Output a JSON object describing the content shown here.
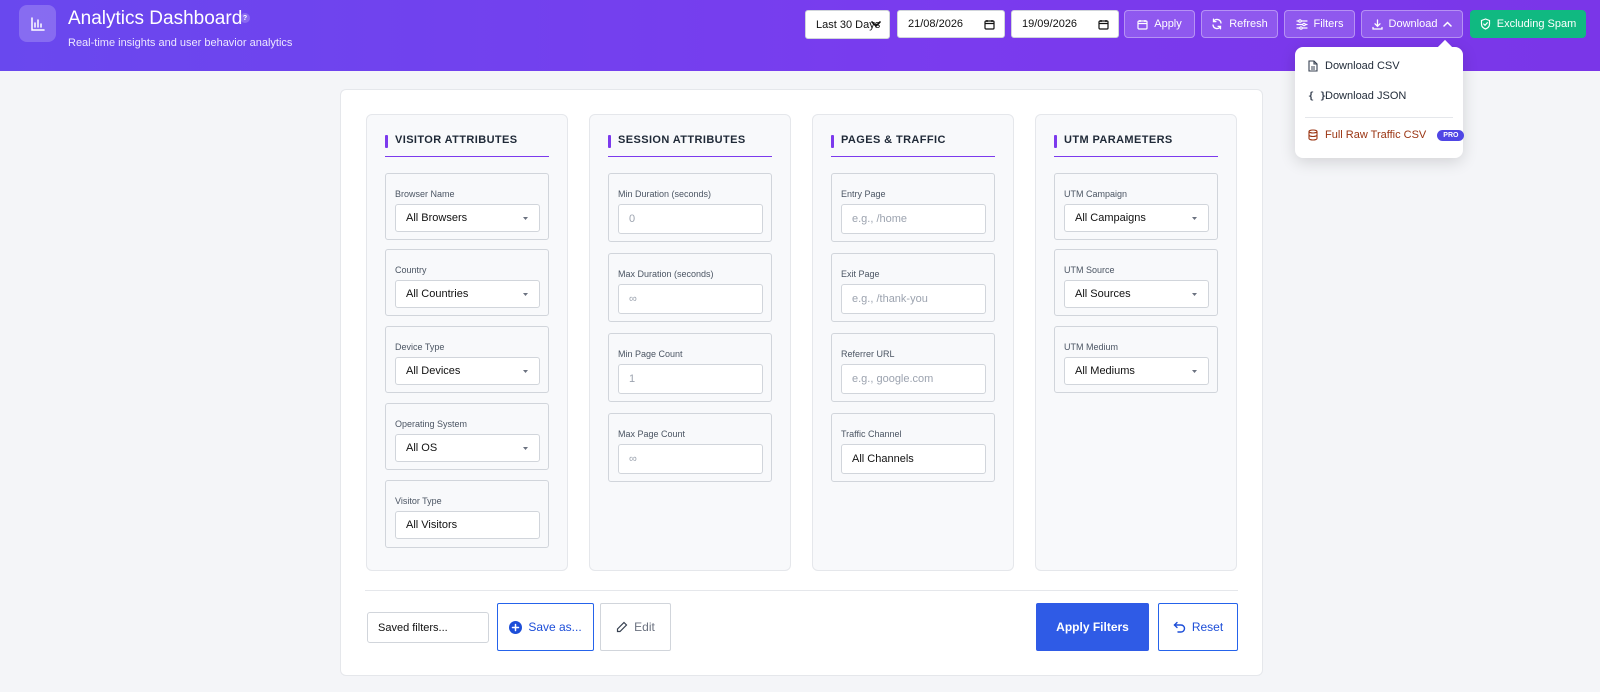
{
  "header": {
    "title": "Analytics Dashboard",
    "info_badge": "?",
    "subtitle": "Real-time insights and user behavior analytics",
    "range_select": "Last 30 Days",
    "start_date": "21/08/2026",
    "end_date": "19/09/2026",
    "apply_label": "Apply",
    "refresh_label": "Refresh",
    "filters_label": "Filters",
    "download_label": "Download",
    "spam_label": "Excluding Spam",
    "icons": [
      "bar-chart-icon",
      "calendar-icon",
      "refresh-icon",
      "sliders-icon",
      "download-icon",
      "chevron-up-icon",
      "shield-check-icon"
    ]
  },
  "download_menu": {
    "csv_label": "Download CSV",
    "json_label": "Download JSON",
    "json_glyph": "{ }",
    "raw_label": "Full Raw Traffic CSV",
    "pro_badge": "PRO"
  },
  "columns": [
    {
      "title": "VISITOR ATTRIBUTES",
      "fields": [
        {
          "label": "Browser Name",
          "value": "All Browsers"
        },
        {
          "label": "Country",
          "value": "All Countries"
        },
        {
          "label": "Device Type",
          "value": "All Devices"
        },
        {
          "label": "Operating System",
          "value": "All OS"
        },
        {
          "label": "Visitor Type",
          "value": "All Visitors"
        }
      ]
    },
    {
      "title": "SESSION ATTRIBUTES",
      "fields": [
        {
          "label": "Min Duration (seconds)",
          "placeholder": "0"
        },
        {
          "label": "Max Duration (seconds)",
          "placeholder": "∞"
        },
        {
          "label": "Min Page Count",
          "placeholder": "1"
        },
        {
          "label": "Max Page Count",
          "placeholder": "∞"
        }
      ]
    },
    {
      "title": "PAGES & TRAFFIC",
      "fields": [
        {
          "label": "Entry Page",
          "placeholder": "e.g., /home"
        },
        {
          "label": "Exit Page",
          "placeholder": "e.g., /thank-you"
        },
        {
          "label": "Referrer URL",
          "placeholder": "e.g., google.com"
        },
        {
          "label": "Traffic Channel",
          "value": "All Channels"
        }
      ]
    },
    {
      "title": "UTM PARAMETERS",
      "fields": [
        {
          "label": "UTM Campaign",
          "value": "All Campaigns"
        },
        {
          "label": "UTM Source",
          "value": "All Sources"
        },
        {
          "label": "UTM Medium",
          "value": "All Mediums"
        }
      ]
    }
  ],
  "footer": {
    "saved_filters": "Saved filters...",
    "save_as_label": "Save as...",
    "edit_label": "Edit",
    "apply_filters_label": "Apply Filters",
    "reset_label": "Reset"
  },
  "colors": {
    "header_gradient_start": "#6948ee",
    "header_gradient_end": "#7a36e8",
    "accent_purple": "#7c3aed",
    "primary_blue": "#2f5be6",
    "spam_green": "#10b981",
    "pro_badge": "#4f46e5"
  }
}
